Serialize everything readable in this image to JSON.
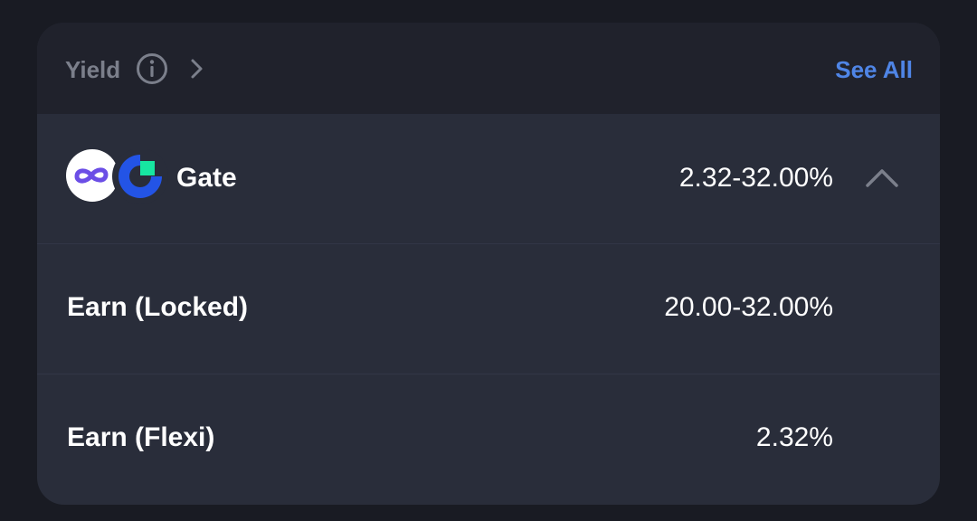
{
  "header": {
    "title": "Yield",
    "see_all_label": "See All"
  },
  "provider": {
    "name": "Gate",
    "rate_range": "2.32-32.00%",
    "icons": [
      "infinity-logo-icon",
      "gate-logo-icon",
      "chevron-up-icon"
    ]
  },
  "products": [
    {
      "label": "Earn (Locked)",
      "rate": "20.00-32.00%"
    },
    {
      "label": "Earn (Flexi)",
      "rate": "2.32%"
    }
  ],
  "colors": {
    "background": "#191b23",
    "card": "#292d3a",
    "header": "#20222c",
    "accent": "#4f85e6",
    "muted_text": "#7b7f8b",
    "gate_blue": "#2354e6",
    "gate_green": "#17e6a1",
    "infinity_purple": "#6b4ee6"
  }
}
